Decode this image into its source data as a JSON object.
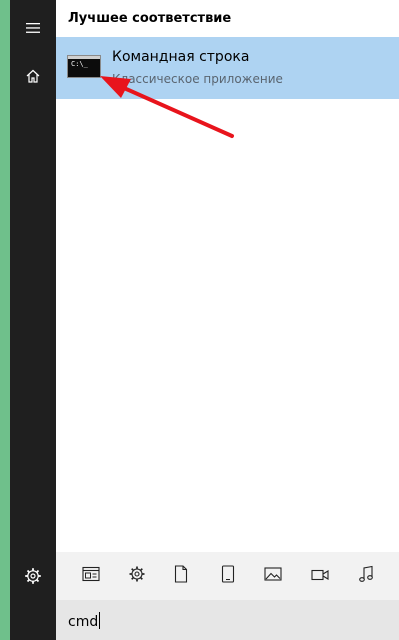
{
  "sidebar": {
    "icons": [
      "hamburger-menu-icon",
      "home-icon",
      "settings-gear-icon"
    ]
  },
  "results": {
    "section_title": "Лучшее соответствие",
    "best_match": {
      "icon": "command-prompt-icon",
      "icon_text": "C:\\_",
      "title": "Командная строка",
      "subtitle": "Классическое приложение"
    }
  },
  "annotation": {
    "arrow_color": "#e8141c"
  },
  "filters": {
    "icons": [
      "apps-filter-icon",
      "settings-filter-icon",
      "documents-filter-icon",
      "tablet-filter-icon",
      "photos-filter-icon",
      "videos-filter-icon",
      "music-filter-icon"
    ]
  },
  "search": {
    "query": "cmd"
  },
  "colors": {
    "accent_strip": "#6fc08b",
    "rail_background": "#1f1f1f",
    "selection_background": "#aed3f2",
    "filter_bar_background": "#f2f2f2",
    "search_background": "#e6e6e6"
  }
}
